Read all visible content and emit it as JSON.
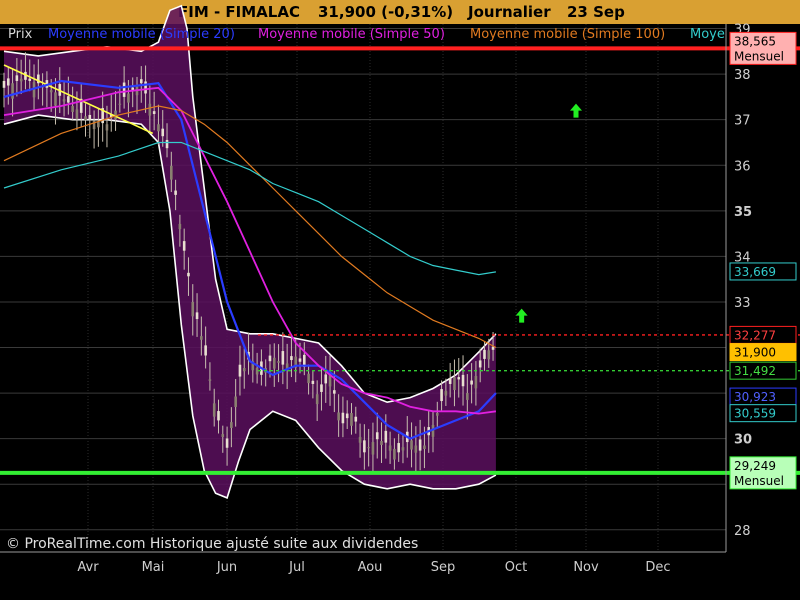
{
  "header": {
    "instrument": "FIM - FIMALAC",
    "quote": "31,900 (-0,31%)",
    "period": "Journalier",
    "date": "23 Sep"
  },
  "legend": [
    {
      "label": "Prix",
      "color": "#d8d8d8"
    },
    {
      "label": "Moyenne mobile (Simple 20)",
      "color": "#2b3cff"
    },
    {
      "label": "Moyenne mobile (Simple 50)",
      "color": "#e020e0"
    },
    {
      "label": "Moyenne mobile (Simple 100)",
      "color": "#e07a20"
    },
    {
      "label": "Moye",
      "color": "#33cccc"
    }
  ],
  "footer_note": "© ProRealTime.com Historique ajusté suite aux dividendes",
  "chart_data": {
    "type": "candlestick",
    "x_labels": [
      "Avr",
      "Mai",
      "Jun",
      "Jul",
      "Aou",
      "Sep",
      "Oct",
      "Nov",
      "Dec"
    ],
    "y_ticks": [
      "39",
      "38",
      "37",
      "36",
      "35",
      "34",
      "33",
      "32",
      "31",
      "30",
      "29",
      "28"
    ],
    "y_range": [
      27.6,
      39.1
    ],
    "price": [
      [
        0,
        37.7
      ],
      [
        6,
        37.9
      ],
      [
        12,
        37.8
      ],
      [
        18,
        37.6
      ],
      [
        24,
        37.3
      ],
      [
        30,
        37.0
      ],
      [
        36,
        36.9
      ],
      [
        42,
        37.5
      ],
      [
        48,
        37.8
      ],
      [
        54,
        36.9
      ],
      [
        58,
        36.2
      ],
      [
        62,
        34.5
      ],
      [
        66,
        33.0
      ],
      [
        70,
        32.0
      ],
      [
        74,
        30.6
      ],
      [
        78,
        29.8
      ],
      [
        82,
        31.3
      ],
      [
        86,
        31.8
      ],
      [
        90,
        31.4
      ],
      [
        94,
        31.8
      ],
      [
        98,
        31.6
      ],
      [
        102,
        31.8
      ],
      [
        106,
        31.5
      ],
      [
        110,
        30.9
      ],
      [
        114,
        31.4
      ],
      [
        118,
        30.3
      ],
      [
        122,
        30.6
      ],
      [
        126,
        29.7
      ],
      [
        130,
        30.0
      ],
      [
        134,
        29.9
      ],
      [
        138,
        29.7
      ],
      [
        142,
        30.0
      ],
      [
        146,
        29.7
      ],
      [
        150,
        30.3
      ],
      [
        154,
        31.0
      ],
      [
        158,
        31.4
      ],
      [
        162,
        31.0
      ],
      [
        166,
        31.5
      ],
      [
        170,
        32.0
      ],
      [
        172,
        31.9
      ]
    ],
    "series": [
      {
        "name": "Moyenne mobile (Simple 20)",
        "color": "#2b3cff",
        "points": [
          [
            0,
            37.5
          ],
          [
            20,
            37.85
          ],
          [
            40,
            37.7
          ],
          [
            54,
            37.8
          ],
          [
            62,
            37.0
          ],
          [
            70,
            35.0
          ],
          [
            78,
            33.0
          ],
          [
            86,
            31.7
          ],
          [
            94,
            31.4
          ],
          [
            102,
            31.6
          ],
          [
            110,
            31.6
          ],
          [
            118,
            31.3
          ],
          [
            126,
            30.8
          ],
          [
            134,
            30.3
          ],
          [
            142,
            30.0
          ],
          [
            150,
            30.2
          ],
          [
            158,
            30.4
          ],
          [
            166,
            30.6
          ],
          [
            172,
            31.0
          ]
        ]
      },
      {
        "name": "Moyenne mobile (Simple 50)",
        "color": "#e020e0",
        "points": [
          [
            0,
            37.1
          ],
          [
            20,
            37.3
          ],
          [
            40,
            37.6
          ],
          [
            54,
            37.7
          ],
          [
            62,
            37.2
          ],
          [
            70,
            36.2
          ],
          [
            78,
            35.2
          ],
          [
            86,
            34.1
          ],
          [
            94,
            33.0
          ],
          [
            102,
            32.1
          ],
          [
            110,
            31.6
          ],
          [
            118,
            31.2
          ],
          [
            126,
            31.0
          ],
          [
            134,
            30.9
          ],
          [
            142,
            30.7
          ],
          [
            150,
            30.6
          ],
          [
            158,
            30.6
          ],
          [
            166,
            30.55
          ],
          [
            172,
            30.6
          ]
        ]
      },
      {
        "name": "Moyenne mobile (Simple 100)",
        "color": "#e07a20",
        "points": [
          [
            0,
            36.1
          ],
          [
            20,
            36.7
          ],
          [
            40,
            37.1
          ],
          [
            54,
            37.3
          ],
          [
            62,
            37.2
          ],
          [
            70,
            36.9
          ],
          [
            78,
            36.5
          ],
          [
            86,
            36.0
          ],
          [
            94,
            35.5
          ],
          [
            102,
            35.0
          ],
          [
            110,
            34.5
          ],
          [
            118,
            34.0
          ],
          [
            126,
            33.6
          ],
          [
            134,
            33.2
          ],
          [
            142,
            32.9
          ],
          [
            150,
            32.6
          ],
          [
            158,
            32.4
          ],
          [
            166,
            32.2
          ],
          [
            172,
            32.0
          ]
        ]
      },
      {
        "name": "Moye",
        "color": "#33cccc",
        "points": [
          [
            0,
            35.5
          ],
          [
            20,
            35.9
          ],
          [
            40,
            36.2
          ],
          [
            54,
            36.5
          ],
          [
            62,
            36.5
          ],
          [
            70,
            36.3
          ],
          [
            78,
            36.1
          ],
          [
            86,
            35.9
          ],
          [
            94,
            35.6
          ],
          [
            102,
            35.4
          ],
          [
            110,
            35.2
          ],
          [
            118,
            34.9
          ],
          [
            126,
            34.6
          ],
          [
            134,
            34.3
          ],
          [
            142,
            34.0
          ],
          [
            150,
            33.8
          ],
          [
            158,
            33.7
          ],
          [
            166,
            33.6
          ],
          [
            172,
            33.66
          ]
        ]
      }
    ],
    "bollinger_upper": [
      [
        0,
        38.5
      ],
      [
        12,
        38.4
      ],
      [
        24,
        38.5
      ],
      [
        36,
        38.6
      ],
      [
        48,
        38.5
      ],
      [
        54,
        38.7
      ],
      [
        58,
        39.4
      ],
      [
        62,
        39.5
      ],
      [
        64,
        39.0
      ],
      [
        66,
        37.5
      ],
      [
        70,
        35.5
      ],
      [
        74,
        33.5
      ],
      [
        78,
        32.4
      ],
      [
        86,
        32.3
      ],
      [
        94,
        32.3
      ],
      [
        102,
        32.2
      ],
      [
        110,
        32.1
      ],
      [
        118,
        31.6
      ],
      [
        126,
        31.0
      ],
      [
        134,
        30.8
      ],
      [
        142,
        30.9
      ],
      [
        150,
        31.1
      ],
      [
        158,
        31.4
      ],
      [
        166,
        31.9
      ],
      [
        172,
        32.3
      ]
    ],
    "bollinger_lower": [
      [
        0,
        36.9
      ],
      [
        12,
        37.1
      ],
      [
        24,
        37.0
      ],
      [
        36,
        37.0
      ],
      [
        48,
        36.9
      ],
      [
        54,
        36.5
      ],
      [
        58,
        35.0
      ],
      [
        62,
        32.5
      ],
      [
        66,
        30.5
      ],
      [
        70,
        29.3
      ],
      [
        74,
        28.8
      ],
      [
        78,
        28.7
      ],
      [
        82,
        29.5
      ],
      [
        86,
        30.2
      ],
      [
        94,
        30.6
      ],
      [
        102,
        30.4
      ],
      [
        110,
        29.8
      ],
      [
        118,
        29.3
      ],
      [
        126,
        29.0
      ],
      [
        134,
        28.9
      ],
      [
        142,
        29.0
      ],
      [
        150,
        28.9
      ],
      [
        158,
        28.9
      ],
      [
        166,
        29.0
      ],
      [
        172,
        29.2
      ]
    ],
    "trend_line": {
      "from": [
        0,
        38.2
      ],
      "to": [
        52,
        36.7
      ],
      "color": "#ffff44"
    },
    "horizontal_levels": [
      {
        "value": 38.565,
        "label": "38,565",
        "sub": "Mensuel",
        "color": "#ff2020",
        "style": "solid",
        "tag_bg": "#000000",
        "tag_fg": "#ff3030"
      },
      {
        "value": 29.249,
        "label": "29,249",
        "sub": "Mensuel",
        "color": "#33ee33",
        "style": "solid",
        "tag_bg": "#000000",
        "tag_fg": "#44ff44"
      },
      {
        "value": 32.277,
        "label": "32,277",
        "color": "#ff2020",
        "style": "dotted",
        "tag_bg": "#000000",
        "tag_fg": "#ff4040"
      },
      {
        "value": 31.492,
        "label": "31,492",
        "color": "#33cc33",
        "style": "dotted",
        "tag_bg": "#000000",
        "tag_fg": "#44dd44"
      }
    ],
    "value_tags": [
      {
        "value": 33.669,
        "label": "33,669",
        "color": "#33cccc",
        "tag_bg": "#000000",
        "tag_fg": "#33cccc"
      },
      {
        "value": 31.9,
        "label": "31,900",
        "color": "#ffc000",
        "tag_bg": "#000000",
        "tag_fg": "#ffc000"
      },
      {
        "value": 30.923,
        "label": "30,923",
        "color": "#2b3cff",
        "tag_bg": "#000000",
        "tag_fg": "#5060ff"
      },
      {
        "value": 30.559,
        "label": "30,559",
        "color": "#33cccc",
        "tag_bg": "#000000",
        "tag_fg": "#33cccc"
      }
    ],
    "signals": [
      {
        "x": 200,
        "y": 37.2,
        "type": "up-arrow",
        "color": "#22ee22"
      },
      {
        "x": 181,
        "y": 32.7,
        "type": "up-arrow",
        "color": "#22ee22"
      }
    ]
  }
}
